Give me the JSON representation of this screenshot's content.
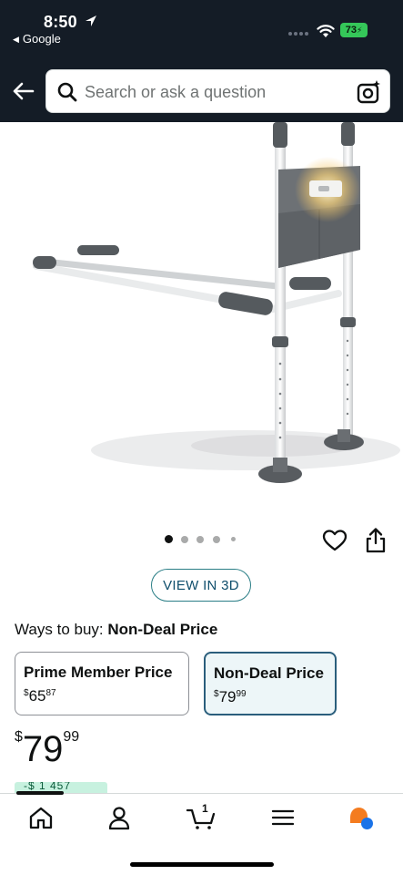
{
  "status_bar": {
    "time": "8:50",
    "back_app": "Google",
    "battery": "73"
  },
  "search": {
    "placeholder": "Search or ask a question"
  },
  "carousel": {
    "total": 5,
    "active_index": 0
  },
  "view_3d": {
    "label": "VIEW IN 3D"
  },
  "ways_to_buy": {
    "label": "Ways to buy:",
    "selected": "Non-Deal Price"
  },
  "options": [
    {
      "title": "Prime Member Price",
      "currency": "$",
      "whole": "65",
      "fraction": "87"
    },
    {
      "title": "Non-Deal Price",
      "currency": "$",
      "whole": "79",
      "fraction": "99"
    }
  ],
  "price": {
    "currency": "$",
    "whole": "79",
    "fraction": "99"
  },
  "savings_chip": {
    "text": "-$ 1 457"
  },
  "bottom_nav": {
    "cart_count": "1",
    "items": [
      "home-icon",
      "account-icon",
      "cart-icon",
      "menu-icon",
      "rufus-icon"
    ]
  },
  "colors": {
    "header_bg": "#141c26",
    "accent_teal": "#2a7e86",
    "selected_border": "#2a5e7c",
    "rufus_orange": "#f47c20",
    "rufus_blue": "#1a73e8"
  }
}
